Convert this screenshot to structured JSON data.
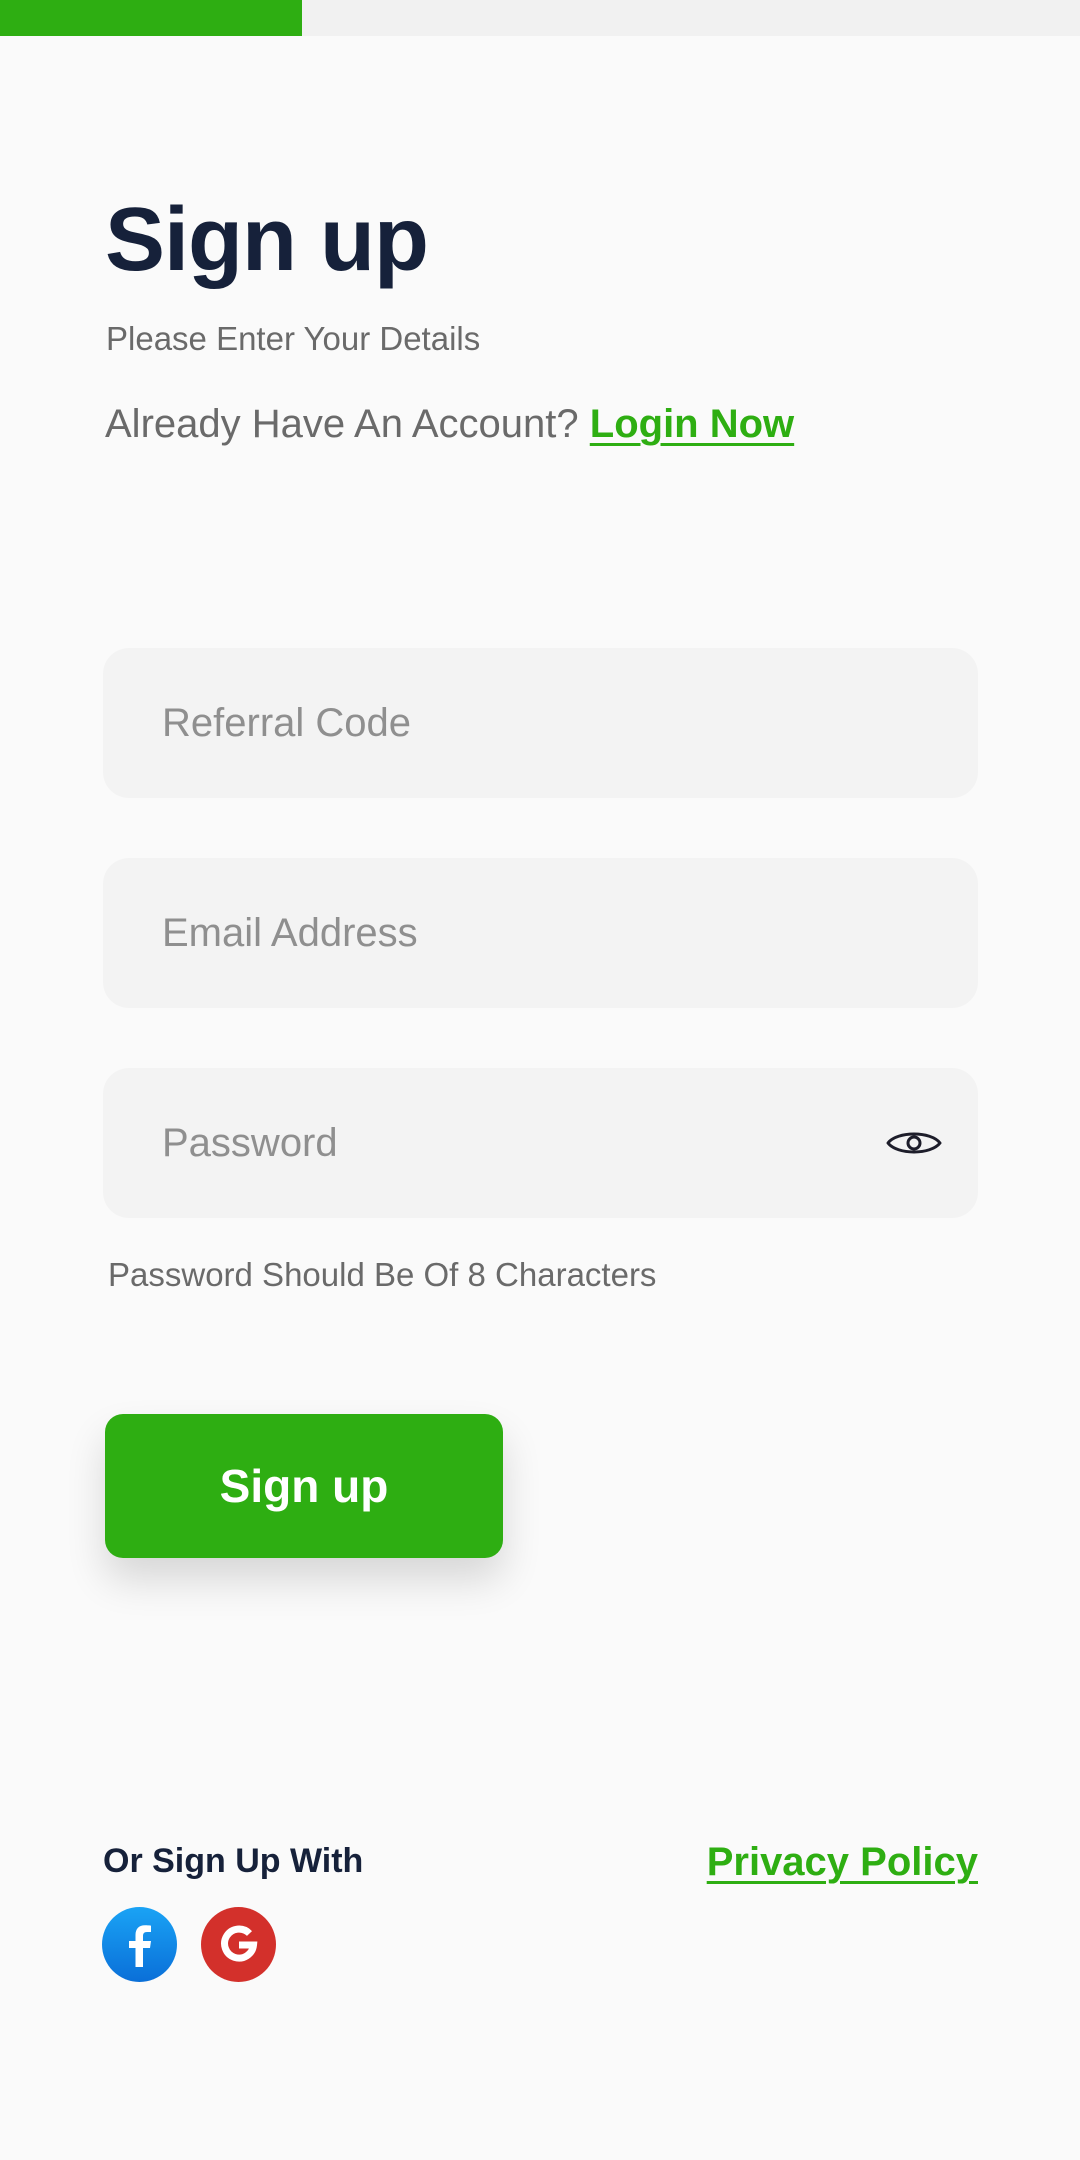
{
  "progress": {
    "percent": 28,
    "color": "#2eae12"
  },
  "header": {
    "title": "Sign up",
    "subtitle": "Please Enter Your Details",
    "account_prompt": "Already Have An Account?",
    "login_link": "Login Now"
  },
  "form": {
    "referral_placeholder": "Referral Code",
    "email_placeholder": "Email Address",
    "password_placeholder": "Password",
    "password_hint": "Password Should Be Of 8 Characters",
    "toggle_icon": "eye-icon",
    "submit_label": "Sign up"
  },
  "footer": {
    "or_sign_up_with": "Or Sign Up With",
    "privacy_policy": "Privacy Policy",
    "social": [
      {
        "icon": "facebook-icon",
        "color": "#0a6fd8"
      },
      {
        "icon": "google-icon",
        "color": "#d3302b"
      }
    ]
  },
  "colors": {
    "accent": "#2eae12",
    "heading": "#16213a",
    "muted": "#6a6a6a",
    "field_bg": "#f3f3f3"
  }
}
